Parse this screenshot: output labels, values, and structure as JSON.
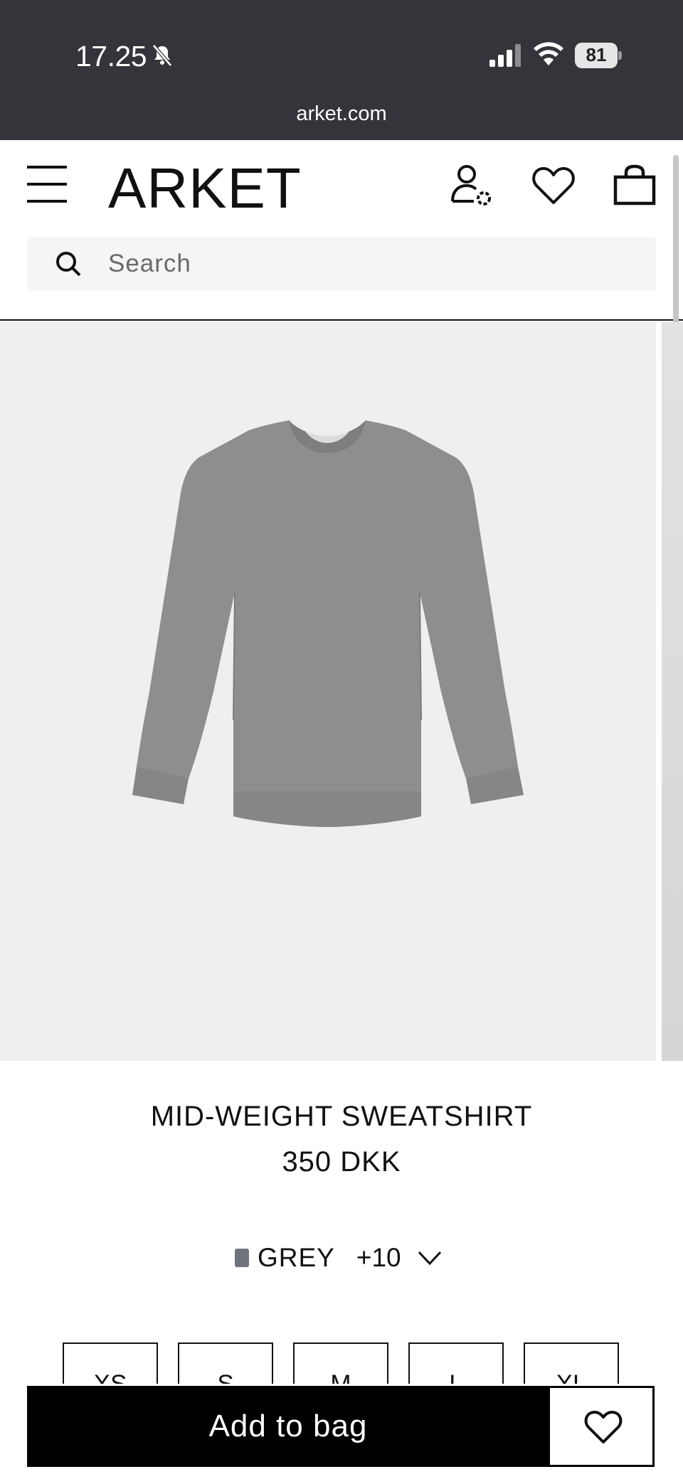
{
  "status_bar": {
    "time": "17.25",
    "battery": "81",
    "url": "arket.com"
  },
  "header": {
    "logo": "ARKET",
    "search_placeholder": "Search"
  },
  "product": {
    "title": "MID-WEIGHT SWEATSHIRT",
    "price": "350 DKK",
    "color": {
      "name": "GREY",
      "more": "+10",
      "swatch_hex": "#6f737b"
    },
    "sizes": [
      "XS",
      "S",
      "M",
      "L",
      "XL"
    ]
  },
  "actions": {
    "add_to_bag": "Add to bag"
  },
  "colors": {
    "status_bar_bg": "#33353a",
    "button_bg": "#000000",
    "image_bg": "#efefef"
  }
}
